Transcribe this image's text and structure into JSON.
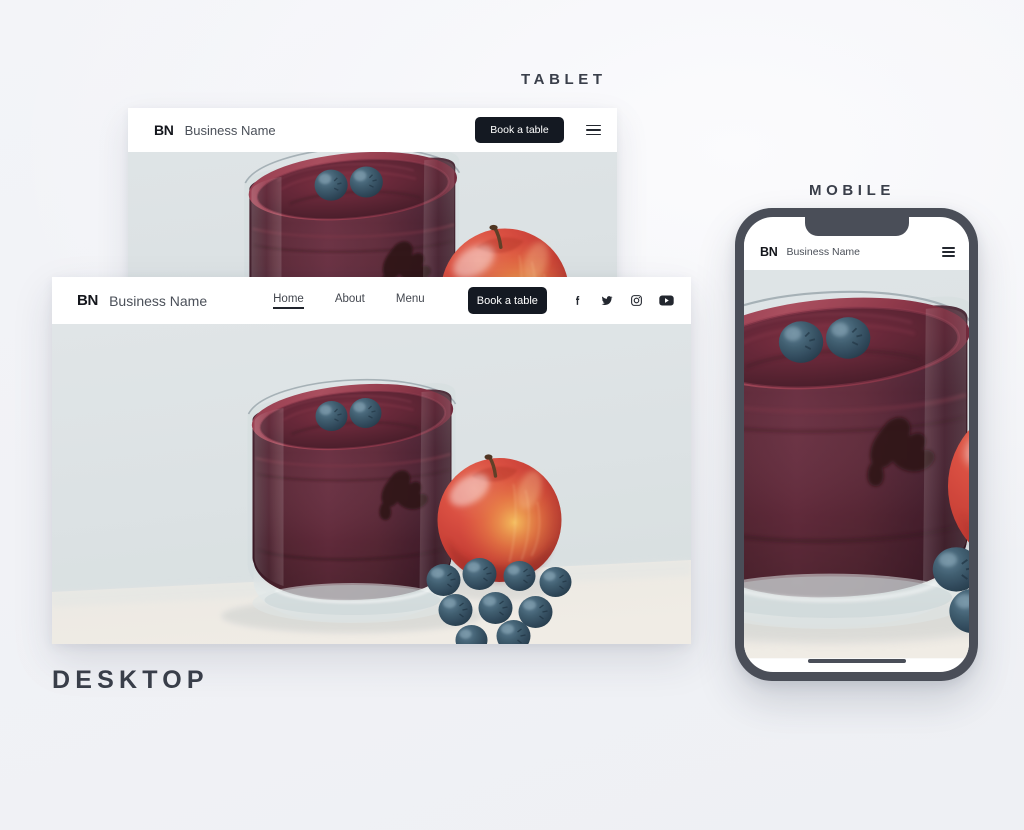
{
  "page": {
    "background_color": "#f1f2f6"
  },
  "labels": {
    "tablet": "TABLET",
    "mobile": "MOBILE",
    "desktop": "DESKTOP"
  },
  "brand": {
    "mark": "BN",
    "name": "Business Name"
  },
  "colors": {
    "cta_background": "#141922",
    "cta_text": "#ffffff",
    "header_background": "#ffffff",
    "text": "#43474f",
    "device_bezel": "#4a4e58",
    "hero_wall": "#dde4e6",
    "hero_table": "#eceae5",
    "smoothie": "#4c1f2c",
    "apple": "#cf3b2f",
    "blueberry": "#2f4a5c"
  },
  "desktop": {
    "nav_links": [
      {
        "label": "Home",
        "active": true
      },
      {
        "label": "About",
        "active": false
      },
      {
        "label": "Menu",
        "active": false
      }
    ],
    "cta_label": "Book a table",
    "socials": [
      {
        "name": "facebook"
      },
      {
        "name": "twitter"
      },
      {
        "name": "instagram"
      },
      {
        "name": "youtube"
      }
    ]
  },
  "tablet": {
    "cta_label": "Book a table",
    "menu_icon": "hamburger-icon"
  },
  "mobile": {
    "menu_icon": "hamburger-icon"
  },
  "hero": {
    "alt": "Glass of dark berry smoothie with blueberries, a red apple and scattered blueberries"
  }
}
